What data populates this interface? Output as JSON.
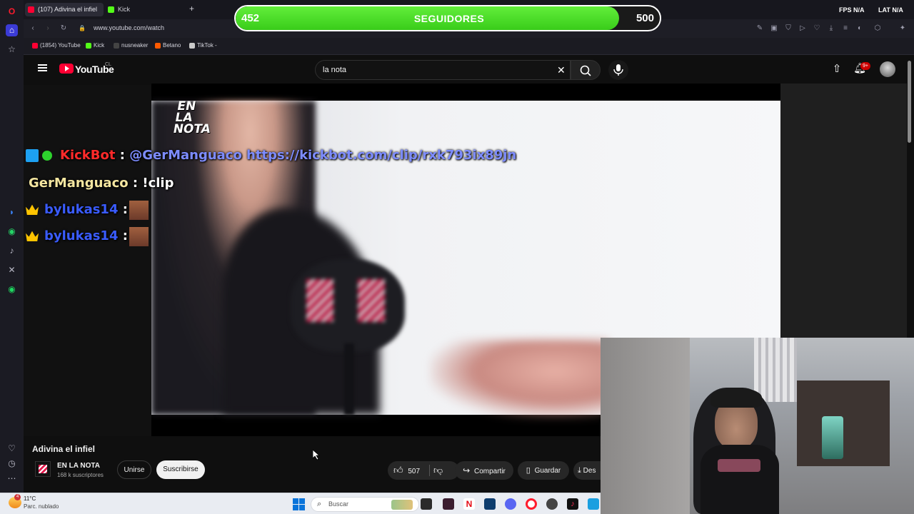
{
  "browser": {
    "tabs": [
      {
        "label": "(107) Adivina el infiel",
        "active": true
      },
      {
        "label": "Kick",
        "active": false
      }
    ],
    "url": "www.youtube.com/watch",
    "bookmarks": [
      "(1854) YouTube",
      "Kick",
      "nusneaker",
      "Betano",
      "TikTok -"
    ],
    "fps_label": "FPS",
    "fps_value": "N/A",
    "lat_label": "LAT",
    "lat_value": "N/A"
  },
  "overlay": {
    "follow_current": "452",
    "follow_label": "SEGUIDORES",
    "follow_goal": "500",
    "follow_progress": 0.904
  },
  "youtube": {
    "logo": "YouTube",
    "country": "CL",
    "search_value": "la nota",
    "notification_badge": "9+"
  },
  "video": {
    "watermark": "EN LA NOTA"
  },
  "chat": [
    {
      "user": "KickBot",
      "separator": ":",
      "message": "@GerManguaco https://kickbot.com/clip/rxk793ix89jn",
      "user_color": "#ff2a2a"
    },
    {
      "user": "GerManguaco",
      "separator": ": ",
      "message": "!clip",
      "user_color": "#f4e6a0"
    },
    {
      "user": "bylukas14",
      "separator": ":",
      "message": "",
      "user_color": "#3a5cff"
    },
    {
      "user": "bylukas14",
      "separator": ":",
      "message": "",
      "user_color": "#3a5cff"
    }
  ],
  "video_info": {
    "title": "Adivina el infiel",
    "channel": "EN LA NOTA",
    "subscribers": "168 k suscriptores",
    "join_label": "Unirse",
    "subscribe_label": "Suscribirse",
    "likes": "507",
    "share_label": "Compartir",
    "save_label": "Guardar",
    "download_label": "Des"
  },
  "taskbar": {
    "weather_temp": "11°C",
    "weather_desc": "Parc. nublado",
    "weather_badge": "4",
    "search_placeholder": "Buscar"
  },
  "colors": {
    "accent_green": "#4fdc2c",
    "youtube_red": "#ff0033",
    "chat_blue": "#3a5cff"
  }
}
